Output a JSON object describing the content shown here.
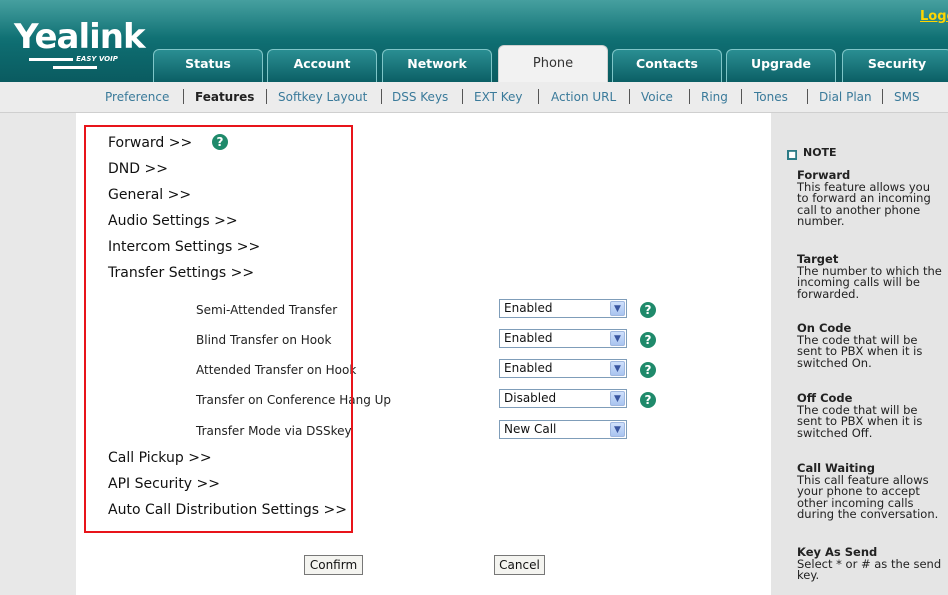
{
  "brand": {
    "logo": "Yealink",
    "tagline": "EASY VOIP",
    "logout": "Logout"
  },
  "tabs": [
    {
      "label": "Status"
    },
    {
      "label": "Account"
    },
    {
      "label": "Network"
    },
    {
      "label": "Phone",
      "active": true
    },
    {
      "label": "Contacts"
    },
    {
      "label": "Upgrade"
    },
    {
      "label": "Security"
    }
  ],
  "subnav": [
    {
      "label": "Preference"
    },
    {
      "label": "Features",
      "active": true
    },
    {
      "label": "Softkey Layout"
    },
    {
      "label": "DSS Keys"
    },
    {
      "label": "EXT Key"
    },
    {
      "label": "Action URL"
    },
    {
      "label": "Voice"
    },
    {
      "label": "Ring"
    },
    {
      "label": "Tones"
    },
    {
      "label": "Dial Plan"
    },
    {
      "label": "SMS"
    }
  ],
  "sections": {
    "forward": "Forward >>",
    "dnd": "DND >>",
    "general": "General >>",
    "audio": "Audio Settings >>",
    "intercom": "Intercom Settings >>",
    "transfer": "Transfer Settings >>",
    "pickup": "Call Pickup >>",
    "api": "API Security >>",
    "acd": "Auto Call Distribution Settings >>"
  },
  "transfer_rows": [
    {
      "label": "Semi-Attended Transfer",
      "value": "Enabled"
    },
    {
      "label": "Blind Transfer on Hook",
      "value": "Enabled"
    },
    {
      "label": "Attended Transfer on Hook",
      "value": "Enabled"
    },
    {
      "label": "Transfer on Conference Hang Up",
      "value": "Disabled"
    },
    {
      "label": "Transfer Mode via DSSkey",
      "value": "New Call"
    }
  ],
  "buttons": {
    "confirm": "Confirm",
    "cancel": "Cancel"
  },
  "help_glyph": "?",
  "note": {
    "heading": "NOTE",
    "items": [
      {
        "title": "Forward",
        "text": "This feature allows you to forward an incoming call to another phone number."
      },
      {
        "title": "Target",
        "text": "The number to which the incoming calls will be forwarded."
      },
      {
        "title": "On Code",
        "text": "The code that will be sent to PBX when it is switched On."
      },
      {
        "title": "Off Code",
        "text": "The code that will be sent to PBX when it is switched Off."
      },
      {
        "title": "Call Waiting",
        "text": "This call feature allows your phone to accept other incoming calls during the conversation."
      },
      {
        "title": "Key As Send",
        "text": "Select * or # as the send key."
      }
    ]
  },
  "colors": {
    "header": "#0e6c70",
    "accent_red": "#e8141a",
    "help": "#1f8a6b",
    "logout": "#ffd500"
  }
}
